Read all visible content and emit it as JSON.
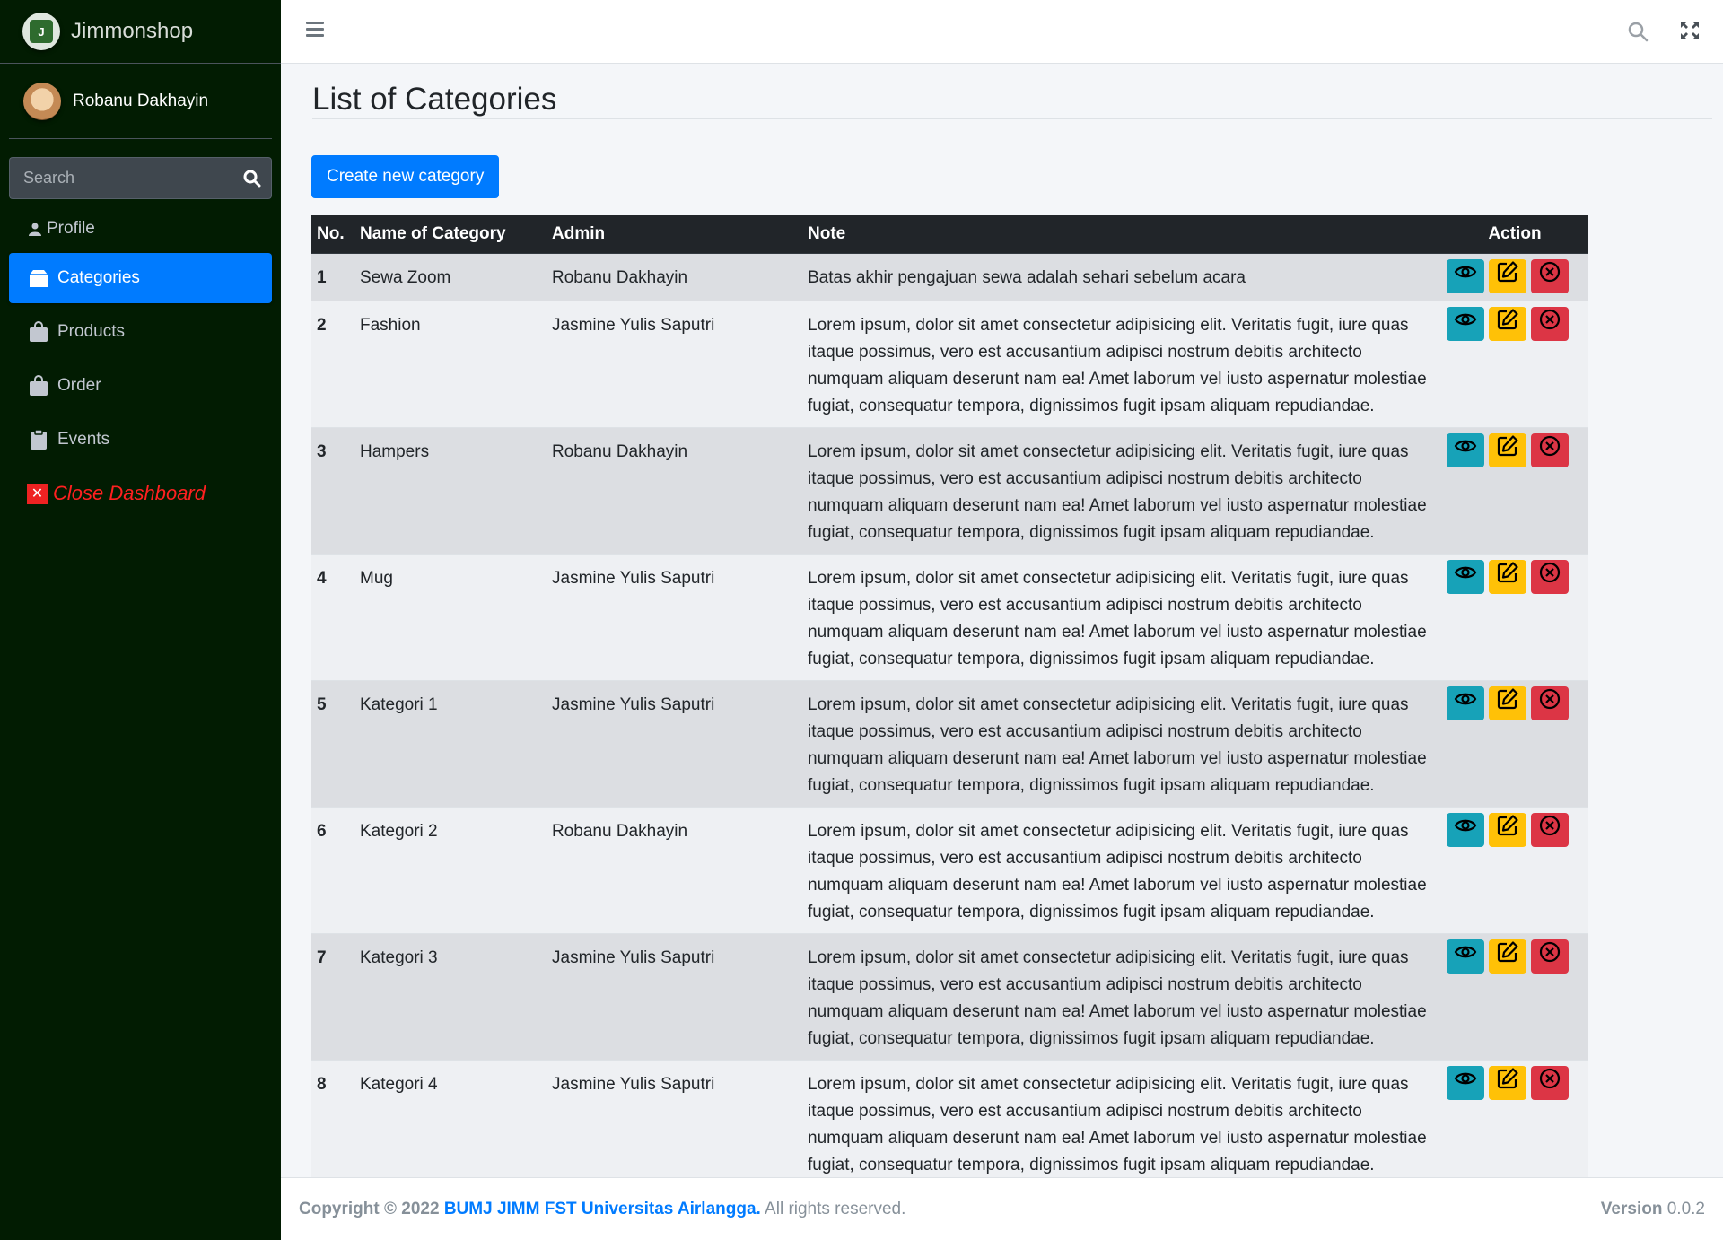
{
  "brand": {
    "name": "Jimmonshop",
    "logo_letter": "J"
  },
  "user": {
    "name": "Robanu Dakhayin"
  },
  "search": {
    "placeholder": "Search"
  },
  "nav": {
    "profile": "Profile",
    "categories": "Categories",
    "products": "Products",
    "order": "Order",
    "events": "Events",
    "close": "Close Dashboard",
    "close_glyph": "✕"
  },
  "page": {
    "title": "List of Categories",
    "create_button": "Create new category"
  },
  "table": {
    "headers": {
      "no": "No.",
      "name": "Name of Category",
      "admin": "Admin",
      "note": "Note",
      "action": "Action"
    },
    "rows": [
      {
        "no": "1",
        "name": "Sewa Zoom",
        "admin": "Robanu Dakhayin",
        "note": "Batas akhir pengajuan sewa adalah sehari sebelum acara"
      },
      {
        "no": "2",
        "name": "Fashion",
        "admin": "Jasmine Yulis Saputri",
        "note": "Lorem ipsum, dolor sit amet consectetur adipisicing elit. Veritatis fugit, iure quas itaque possimus, vero est accusantium adipisci nostrum debitis architecto numquam aliquam deserunt nam ea! Amet laborum vel iusto aspernatur molestiae fugiat, consequatur tempora, dignissimos fugit ipsam aliquam repudiandae."
      },
      {
        "no": "3",
        "name": "Hampers",
        "admin": "Robanu Dakhayin",
        "note": "Lorem ipsum, dolor sit amet consectetur adipisicing elit. Veritatis fugit, iure quas itaque possimus, vero est accusantium adipisci nostrum debitis architecto numquam aliquam deserunt nam ea! Amet laborum vel iusto aspernatur molestiae fugiat, consequatur tempora, dignissimos fugit ipsam aliquam repudiandae."
      },
      {
        "no": "4",
        "name": "Mug",
        "admin": "Jasmine Yulis Saputri",
        "note": "Lorem ipsum, dolor sit amet consectetur adipisicing elit. Veritatis fugit, iure quas itaque possimus, vero est accusantium adipisci nostrum debitis architecto numquam aliquam deserunt nam ea! Amet laborum vel iusto aspernatur molestiae fugiat, consequatur tempora, dignissimos fugit ipsam aliquam repudiandae."
      },
      {
        "no": "5",
        "name": "Kategori 1",
        "admin": "Jasmine Yulis Saputri",
        "note": "Lorem ipsum, dolor sit amet consectetur adipisicing elit. Veritatis fugit, iure quas itaque possimus, vero est accusantium adipisci nostrum debitis architecto numquam aliquam deserunt nam ea! Amet laborum vel iusto aspernatur molestiae fugiat, consequatur tempora, dignissimos fugit ipsam aliquam repudiandae."
      },
      {
        "no": "6",
        "name": "Kategori 2",
        "admin": "Robanu Dakhayin",
        "note": "Lorem ipsum, dolor sit amet consectetur adipisicing elit. Veritatis fugit, iure quas itaque possimus, vero est accusantium adipisci nostrum debitis architecto numquam aliquam deserunt nam ea! Amet laborum vel iusto aspernatur molestiae fugiat, consequatur tempora, dignissimos fugit ipsam aliquam repudiandae."
      },
      {
        "no": "7",
        "name": "Kategori 3",
        "admin": "Jasmine Yulis Saputri",
        "note": "Lorem ipsum, dolor sit amet consectetur adipisicing elit. Veritatis fugit, iure quas itaque possimus, vero est accusantium adipisci nostrum debitis architecto numquam aliquam deserunt nam ea! Amet laborum vel iusto aspernatur molestiae fugiat, consequatur tempora, dignissimos fugit ipsam aliquam repudiandae."
      },
      {
        "no": "8",
        "name": "Kategori 4",
        "admin": "Jasmine Yulis Saputri",
        "note": "Lorem ipsum, dolor sit amet consectetur adipisicing elit. Veritatis fugit, iure quas itaque possimus, vero est accusantium adipisci nostrum debitis architecto numquam aliquam deserunt nam ea! Amet laborum vel iusto aspernatur molestiae fugiat, consequatur tempora, dignissimos fugit ipsam aliquam repudiandae."
      }
    ]
  },
  "footer": {
    "copyright": "Copyright © 2022",
    "org": "BUMJ JIMM FST Universitas Airlangga.",
    "rights": "All rights reserved.",
    "version_label": "Version",
    "version": "0.0.2"
  },
  "icons": {
    "menu": "hamburger-icon",
    "search": "search-icon",
    "expand": "expand-icon",
    "view": "eye-icon",
    "edit": "edit-icon",
    "delete": "close-circle-icon"
  },
  "colors": {
    "sidebar": "#021c02",
    "primary": "#007bff",
    "view": "#17a2b8",
    "edit": "#ffc107",
    "delete": "#dc3545",
    "close_link": "#ff2020"
  }
}
